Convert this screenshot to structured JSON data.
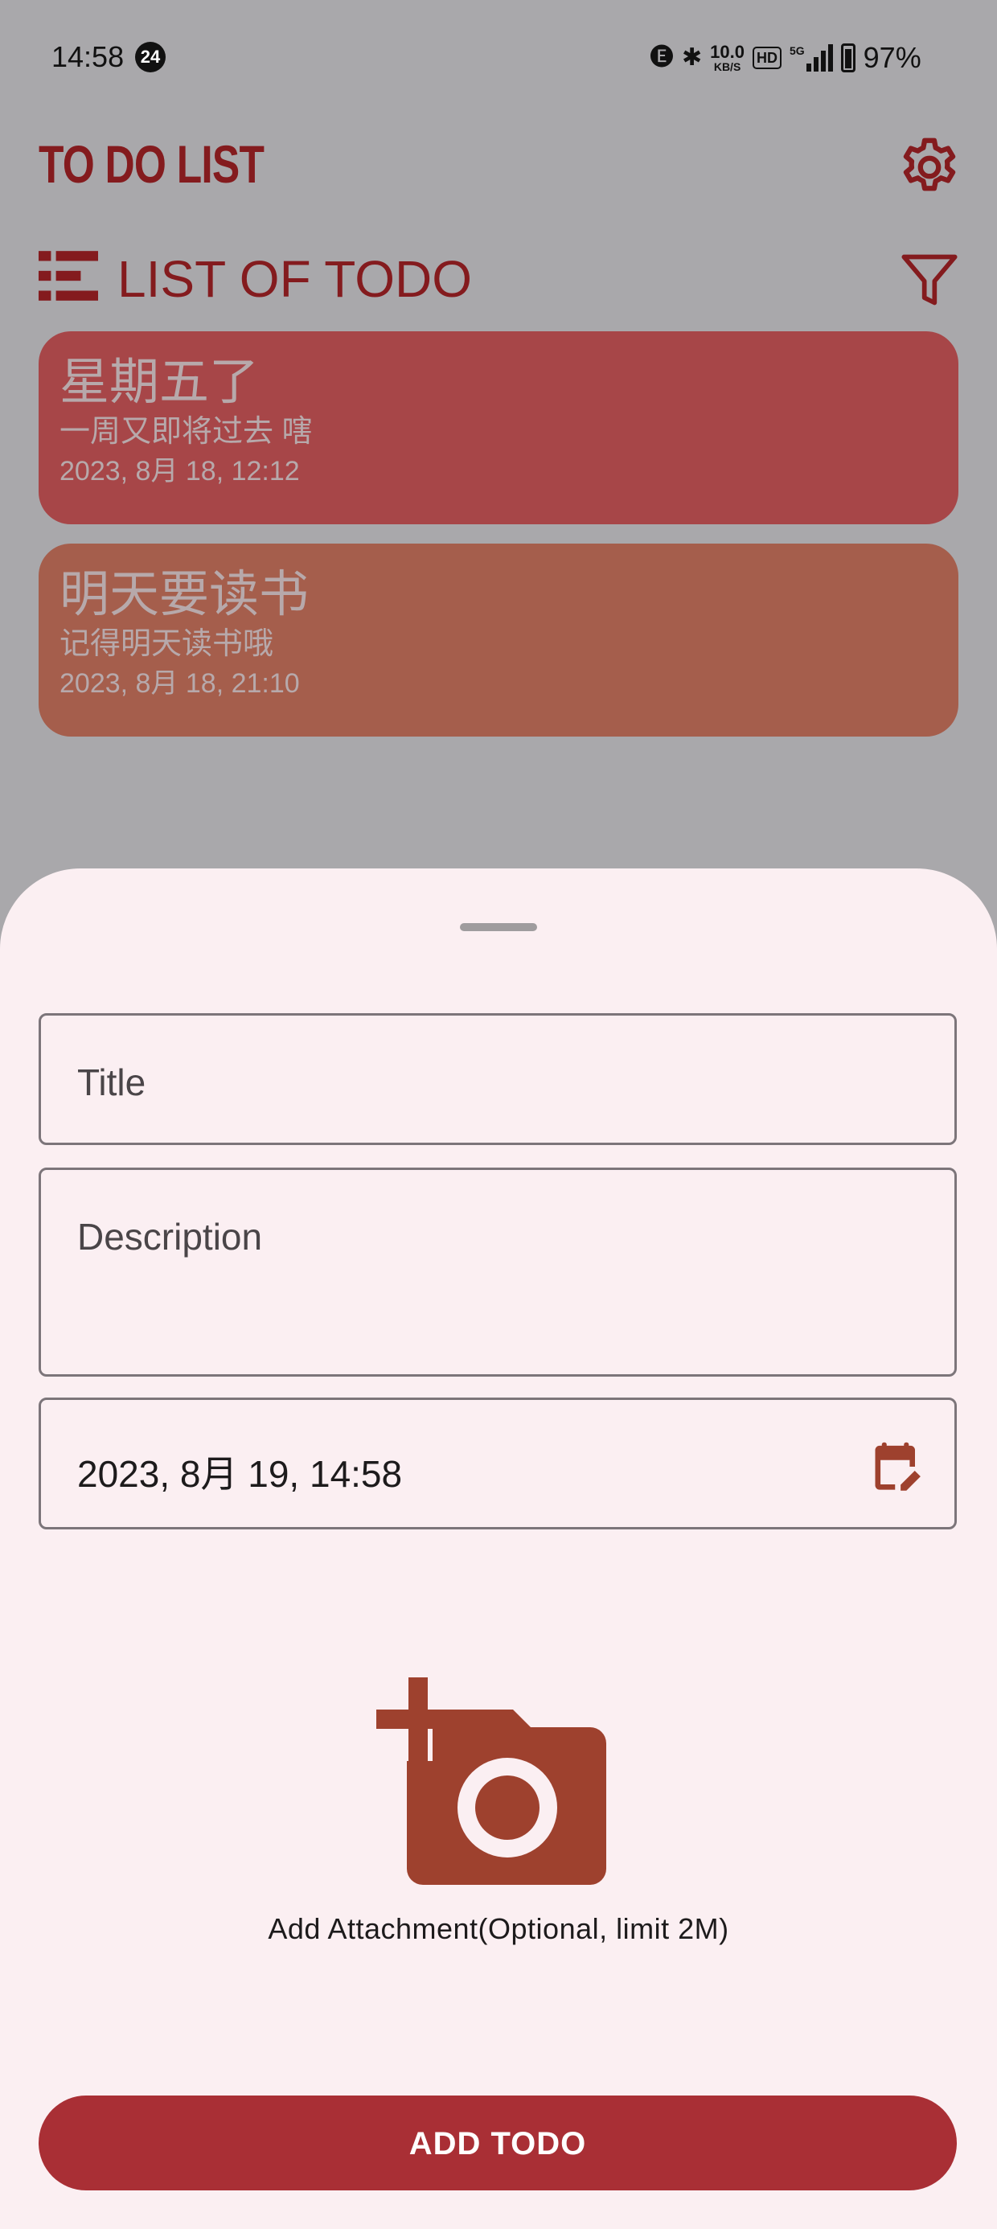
{
  "status_bar": {
    "time": "14:58",
    "notification_count": "24",
    "net_speed_value": "10.0",
    "net_speed_unit": "KB/S",
    "hd_label": "HD",
    "network_label": "5G",
    "battery_percent": "97%"
  },
  "header": {
    "app_title": "TO DO LIST",
    "settings_icon": "gear-icon"
  },
  "section": {
    "title": "LIST OF TODO",
    "list_icon": "list-icon",
    "filter_icon": "filter-icon"
  },
  "todos": [
    {
      "title": "星期五了",
      "description": "一周又即将过去 嗐",
      "date": "2023, 8月 18, 12:12",
      "color": "#a74648"
    },
    {
      "title": "明天要读书",
      "description": "记得明天读书哦",
      "date": "2023, 8月 18, 21:10",
      "color": "#a55e4c"
    }
  ],
  "sheet": {
    "title_placeholder": "Title",
    "description_placeholder": "Description",
    "date_value": "2023, 8月 19, 14:58",
    "calendar_icon": "calendar-edit-icon",
    "attachment_icon": "add-photo-icon",
    "attachment_label": "Add Attachment(Optional, limit 2M)",
    "add_button_label": "ADD TODO"
  },
  "colors": {
    "accent": "#a92f35",
    "title_color": "#841b1e",
    "icon_color": "#9e412e",
    "sheet_bg": "#fbeff2",
    "scrim_bg": "#a9a8ab"
  }
}
